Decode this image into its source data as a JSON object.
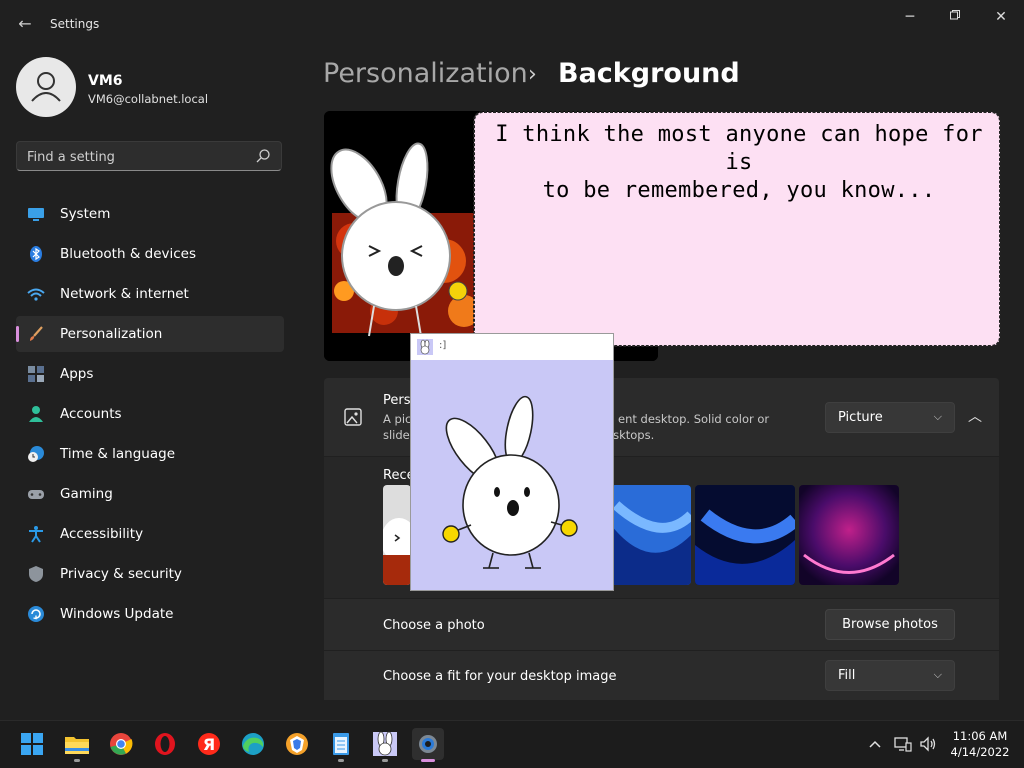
{
  "window": {
    "title": "Settings"
  },
  "profile": {
    "name": "VM6",
    "email": "VM6@collabnet.local"
  },
  "search": {
    "placeholder": "Find a setting"
  },
  "sidebar": {
    "items": [
      {
        "label": "System",
        "icon": "monitor-icon"
      },
      {
        "label": "Bluetooth & devices",
        "icon": "bluetooth-icon"
      },
      {
        "label": "Network & internet",
        "icon": "wifi-icon"
      },
      {
        "label": "Personalization",
        "icon": "brush-icon",
        "active": true
      },
      {
        "label": "Apps",
        "icon": "apps-icon"
      },
      {
        "label": "Accounts",
        "icon": "person-icon"
      },
      {
        "label": "Time & language",
        "icon": "clock-globe-icon"
      },
      {
        "label": "Gaming",
        "icon": "gamepad-icon"
      },
      {
        "label": "Accessibility",
        "icon": "accessibility-icon"
      },
      {
        "label": "Privacy & security",
        "icon": "shield-icon"
      },
      {
        "label": "Windows Update",
        "icon": "update-icon"
      }
    ]
  },
  "breadcrumb": {
    "parent": "Personalization",
    "separator": "›",
    "current": "Background"
  },
  "personalize": {
    "title": "Perso",
    "desc_line1_left": "A pic",
    "desc_line1_right": "ent desktop. Solid color or",
    "desc_line2_left": "slide",
    "desc_line2_right": "esktops.",
    "type_value": "Picture"
  },
  "recent": {
    "label": "Rece"
  },
  "photo_row": {
    "label": "Choose a photo",
    "button": "Browse photos"
  },
  "fit_row": {
    "label": "Choose a fit for your desktop image",
    "value": "Fill"
  },
  "popup": {
    "title": ":]",
    "bubble_line1": "I think the most anyone can hope for is",
    "bubble_line2": "to be remembered, you know..."
  },
  "taskbar": {
    "apps": [
      "start-icon",
      "file-explorer-icon",
      "chrome-icon",
      "opera-icon",
      "yandex-icon",
      "edge-icon",
      "brave-icon",
      "notepad-icon",
      "bunny-app-icon",
      "settings-icon"
    ],
    "time": "11:06 AM",
    "date": "4/14/2022"
  },
  "colors": {
    "accent": "#d98fdc",
    "background": "#202020",
    "card": "#2b2b2b",
    "bubble": "#fde0f3",
    "popup_bg": "#c9c8f6"
  }
}
